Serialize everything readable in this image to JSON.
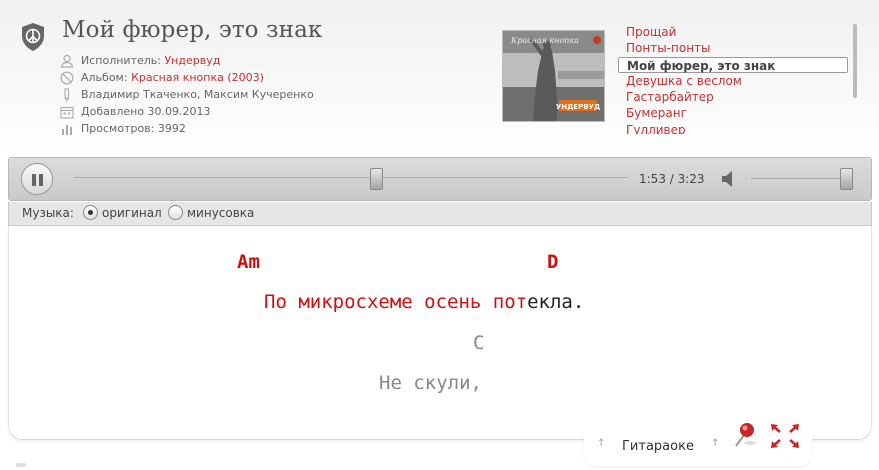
{
  "song": {
    "title": "Мой фюрер, это знак",
    "artist_label": "Исполнитель:",
    "artist": "Ундервуд",
    "album_label": "Альбом:",
    "album": "Красная кнопка (2003)",
    "authors": "Владимир Ткаченко, Максим Кучеренко",
    "added": "Добавлено 30.09.2013",
    "views": "Просмотров: 3992",
    "cover": {
      "text_top": "Красная кнопка",
      "brand": "УНДЕРВУД"
    }
  },
  "playlist": {
    "items": [
      {
        "label": "Прощай",
        "active": false
      },
      {
        "label": "Понты-понты",
        "active": false
      },
      {
        "label": "Мой фюрер, это знак",
        "active": true
      },
      {
        "label": "Девушка с веслом",
        "active": false
      },
      {
        "label": "Гастарбайтер",
        "active": false
      },
      {
        "label": "Бумеранг",
        "active": false
      },
      {
        "label": "Гулливер",
        "active": false
      }
    ]
  },
  "player": {
    "state": "playing",
    "progress": 0.547,
    "time": "1:53 / 3:23",
    "volume": 1.0
  },
  "music_mode": {
    "label": "Музыка:",
    "options": [
      {
        "label": "оригинал",
        "selected": true
      },
      {
        "label": "минусовка",
        "selected": false
      }
    ]
  },
  "lyrics": {
    "line1_chords": {
      "chord1": "Am",
      "chord2": "D"
    },
    "line1_text": {
      "sung": "По микросхеме осень пот",
      "unsung": "екла."
    },
    "line2_chord": "C",
    "line2_text": "Не скули,"
  },
  "toolbar": {
    "tab_label": "Гитараоке"
  },
  "colors": {
    "accent_red": "#cc1111",
    "link_red": "#c03232"
  }
}
